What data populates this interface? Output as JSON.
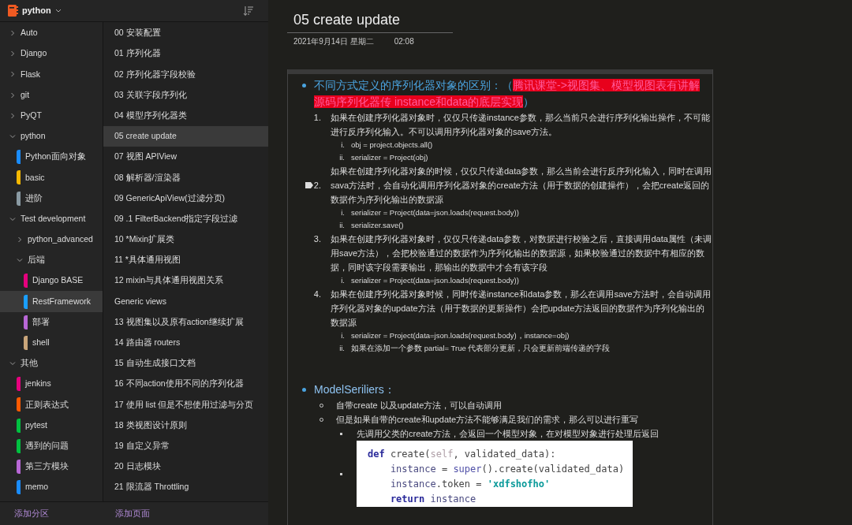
{
  "notebook": {
    "title": "python"
  },
  "sections": [
    {
      "label": "Auto",
      "kind": "group",
      "expanded": false,
      "selected": false
    },
    {
      "label": "Django",
      "kind": "group",
      "expanded": false,
      "selected": false
    },
    {
      "label": "Flask",
      "kind": "group",
      "expanded": false,
      "selected": false
    },
    {
      "label": "git",
      "kind": "group",
      "expanded": false,
      "selected": false
    },
    {
      "label": "PyQT",
      "kind": "group",
      "expanded": false,
      "selected": false
    },
    {
      "label": "python",
      "kind": "group",
      "expanded": true,
      "selected": false,
      "children": [
        {
          "label": "Python面向对象",
          "kind": "section",
          "color": "#1a8cff",
          "selected": false
        },
        {
          "label": "basic",
          "kind": "section",
          "color": "#f5b800",
          "selected": false
        },
        {
          "label": "进阶",
          "kind": "section",
          "color": "#8a9aa3",
          "selected": false
        }
      ]
    },
    {
      "label": "Test development",
      "kind": "group",
      "expanded": true,
      "selected": false,
      "children": [
        {
          "label": "python_advanced",
          "kind": "group",
          "expanded": false,
          "selected": false
        },
        {
          "label": "后端",
          "kind": "group",
          "expanded": true,
          "selected": false,
          "children": [
            {
              "label": "Django BASE",
              "kind": "section",
              "color": "#e6007e",
              "selected": false
            },
            {
              "label": "RestFramework",
              "kind": "section",
              "color": "#1a9fff",
              "selected": true
            },
            {
              "label": "部署",
              "kind": "section",
              "color": "#b867d6",
              "selected": false
            },
            {
              "label": "shell",
              "kind": "section",
              "color": "#c9a57a",
              "selected": false
            }
          ]
        }
      ]
    },
    {
      "label": "其他",
      "kind": "group",
      "expanded": true,
      "selected": false,
      "children": [
        {
          "label": "jenkins",
          "kind": "section",
          "color": "#e6007e",
          "selected": false
        },
        {
          "label": "正则表达式",
          "kind": "section",
          "color": "#ff5a00",
          "selected": false
        },
        {
          "label": "pytest",
          "kind": "section",
          "color": "#00c040",
          "selected": false
        },
        {
          "label": "遇到的问题",
          "kind": "section",
          "color": "#00c040",
          "selected": false
        },
        {
          "label": "第三方模块",
          "kind": "section",
          "color": "#b867d6",
          "selected": false
        },
        {
          "label": "memo",
          "kind": "section",
          "color": "#1a8cff",
          "selected": false
        }
      ]
    }
  ],
  "pages": [
    {
      "label": "00 安装配置",
      "selected": false
    },
    {
      "label": "01 序列化器",
      "selected": false
    },
    {
      "label": "02 序列化器字段校验",
      "selected": false
    },
    {
      "label": "03 关联字段序列化",
      "selected": false
    },
    {
      "label": "04 模型序列化器类",
      "selected": false
    },
    {
      "label": "05 create update",
      "selected": true
    },
    {
      "label": "07 视图 APIView",
      "selected": false
    },
    {
      "label": "08 解析器/渲染器",
      "selected": false
    },
    {
      "label": "09 GenericApiView(过滤分页)",
      "selected": false
    },
    {
      "label": "09 .1 FilterBackend指定字段过滤",
      "selected": false
    },
    {
      "label": "10 *Mixin扩展类",
      "selected": false
    },
    {
      "label": "11 *具体通用视图",
      "selected": false
    },
    {
      "label": "12 mixin与具体通用视图关系",
      "selected": false
    },
    {
      "label": "Generic views",
      "selected": false
    },
    {
      "label": "13 视图集以及原有action继续扩展",
      "selected": false
    },
    {
      "label": "14 路由器 routers",
      "selected": false
    },
    {
      "label": "15 自动生成接口文档",
      "selected": false
    },
    {
      "label": "16 不同action使用不同的序列化器",
      "selected": false
    },
    {
      "label": "17 使用 list 但是不想使用过滤与分页",
      "selected": false
    },
    {
      "label": "18 类视图设计原则",
      "selected": false
    },
    {
      "label": "19 自定义异常",
      "selected": false
    },
    {
      "label": "20 日志模块",
      "selected": false
    },
    {
      "label": "21 限流器 Throttling",
      "selected": false
    }
  ],
  "add_section": "添加分区",
  "add_page": "添加页面",
  "page": {
    "title": "05 create update",
    "date": "2021年9月14日 星期二",
    "time": "02:08",
    "blocks": [
      {
        "heading": [
          {
            "text": "不同方式定义的序列化器对象的区别：（",
            "highlighted": false
          },
          {
            "text": "腾讯课堂->视图集、模型视图表有讲解源码序列化器传 instance和data的底层实现",
            "highlighted": true
          },
          {
            "text": "）",
            "highlighted": false
          }
        ],
        "items": [
          {
            "number": "1.",
            "tagged": false,
            "text": "如果在创建序列化器对象时，仅仅只传递instance参数，那么当前只会进行序列化输出操作，不可能进行反序列化输入。不可以调用序列化器对象的save方法。",
            "subs": [
              {
                "number": "i.",
                "text": "obj = project.objects.all()"
              },
              {
                "number": "ii.",
                "text": "serializer = Project(obj)"
              }
            ]
          },
          {
            "number": "2.",
            "tagged": true,
            "text": "如果在创建序列化器对象的时候，仅仅只传递data参数，那么当前会进行反序列化输入，同时在调用sava方法时，会自动化调用序列化器对象的create方法（用于数据的创建操作），会把create返回的数据作为序列化输出的数据源",
            "subs": [
              {
                "number": "i.",
                "text": "serializer = Project(data=json.loads(request.body))"
              },
              {
                "number": "ii.",
                "text": "serializer.save()"
              }
            ]
          },
          {
            "number": "3.",
            "tagged": false,
            "text": "如果在创建序列化器对象时，仅仅只传递data参数，对数据进行校验之后，直接调用data属性（未调用save方法），会把校验通过的数据作为序列化输出的数据源，如果校验通过的数据中有相应的数据，同时该字段需要输出，那输出的数据中才会有该字段",
            "subs": [
              {
                "number": "i.",
                "text": "serializer = Project(data=json.loads(request.body))"
              }
            ]
          },
          {
            "number": "4.",
            "tagged": false,
            "text": "如果在创建序列化器对象时候，同时传递instance和data参数，那么在调用save方法时，会自动调用序列化器对象的update方法（用于数据的更新操作）会把update方法返回的数据作为序列化输出的数据源",
            "subs": [
              {
                "number": "i.",
                "text": "serializer = Project(data=json.loads(request.body)，instance=obj)"
              },
              {
                "number": "ii.",
                "text": "如果在添加一个参数 partial= True 代表部分更新，只会更新前端传递的字段"
              }
            ]
          }
        ]
      },
      {
        "heading": [
          {
            "text": "ModelSeriliers：",
            "highlighted": false
          }
        ],
        "bullets": [
          {
            "text": "自带create 以及update方法，可以自动调用"
          },
          {
            "text": "但是如果自带的create和update方法不能够满足我们的需求，那么可以进行重写",
            "subs": [
              {
                "kind": "text",
                "text": "先调用父类的create方法，会返回一个模型对象，在对模型对象进行处理后返回"
              },
              {
                "kind": "code",
                "lines": [
                  [
                    {
                      "text": "def",
                      "kind": "keyword"
                    },
                    {
                      "text": " create(",
                      "kind": "plain"
                    },
                    {
                      "text": "self",
                      "kind": "self"
                    },
                    {
                      "text": ", validated_data):",
                      "kind": "plain"
                    }
                  ],
                  [
                    {
                      "text": "    instance",
                      "kind": "name"
                    },
                    {
                      "text": " = ",
                      "kind": "plain"
                    },
                    {
                      "text": "super",
                      "kind": "builtin"
                    },
                    {
                      "text": "().create(validated_data)",
                      "kind": "plain"
                    }
                  ],
                  [
                    {
                      "text": "    instance",
                      "kind": "name"
                    },
                    {
                      "text": ".token = ",
                      "kind": "plain"
                    },
                    {
                      "text": "'xdfshofho'",
                      "kind": "string"
                    }
                  ],
                  [
                    {
                      "text": "    return",
                      "kind": "keyword"
                    },
                    {
                      "text": " instance",
                      "kind": "name"
                    }
                  ]
                ]
              }
            ]
          }
        ]
      }
    ]
  }
}
